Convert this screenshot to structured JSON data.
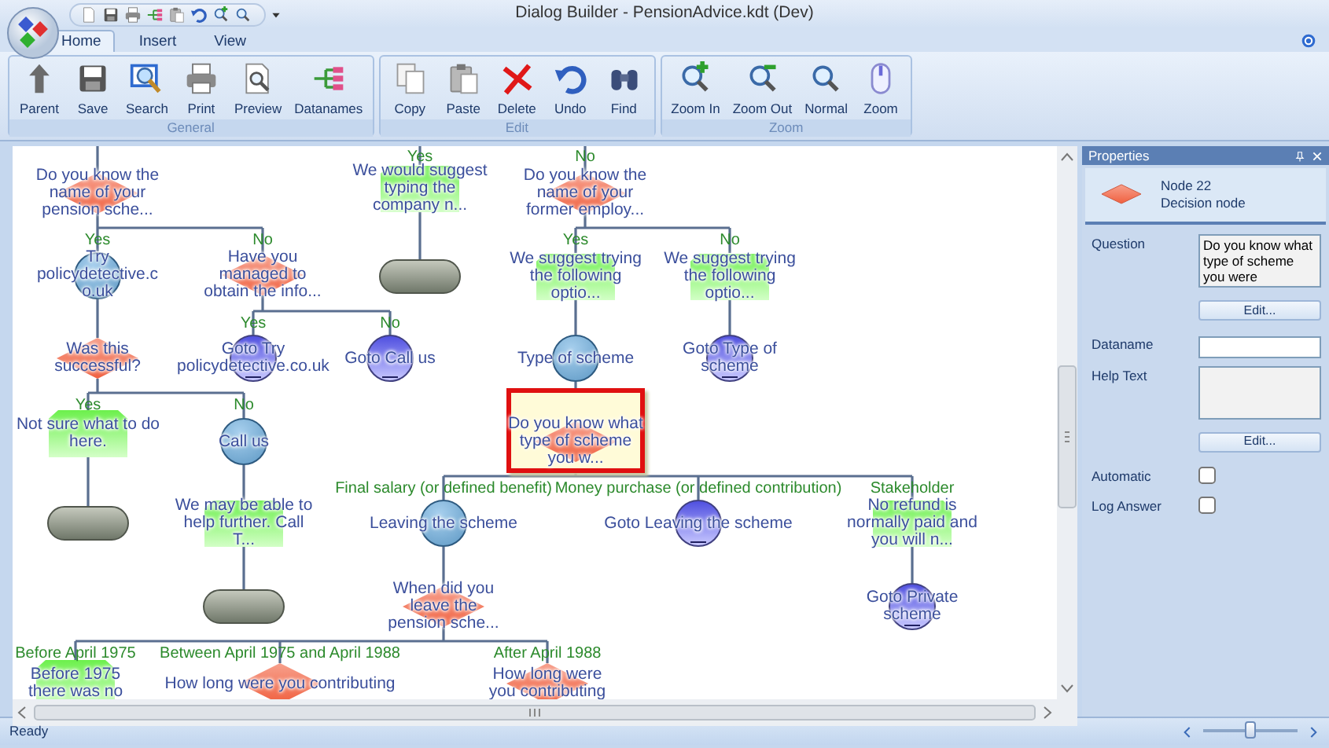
{
  "window": {
    "title": "Dialog Builder - PensionAdvice.kdt (Dev)"
  },
  "tabs": [
    {
      "label": "Home",
      "selected": true
    },
    {
      "label": "Insert",
      "selected": false
    },
    {
      "label": "View",
      "selected": false
    }
  ],
  "ribbon": [
    {
      "label": "General",
      "buttons": [
        {
          "label": "Parent",
          "kind": "parent"
        },
        {
          "label": "Save",
          "kind": "save"
        },
        {
          "label": "Search",
          "kind": "search"
        },
        {
          "label": "Print",
          "kind": "print"
        },
        {
          "label": "Preview",
          "kind": "preview"
        },
        {
          "label": "Datanames",
          "kind": "datanames"
        }
      ]
    },
    {
      "label": "Edit",
      "buttons": [
        {
          "label": "Copy",
          "kind": "copy"
        },
        {
          "label": "Paste",
          "kind": "paste"
        },
        {
          "label": "Delete",
          "kind": "delete"
        },
        {
          "label": "Undo",
          "kind": "undo"
        },
        {
          "label": "Find",
          "kind": "find"
        }
      ]
    },
    {
      "label": "Zoom",
      "buttons": [
        {
          "label": "Zoom In",
          "kind": "zoomin"
        },
        {
          "label": "Zoom Out",
          "kind": "zoomout"
        },
        {
          "label": "Normal",
          "kind": "normal"
        },
        {
          "label": "Zoom",
          "kind": "zoom"
        }
      ]
    }
  ],
  "diagram": {
    "nodes": [
      {
        "kind": "decision",
        "text": "Do you know the name of your pension sche...",
        "selected": false,
        "children": [
          {
            "kind": "info",
            "branch": "Yes",
            "text": "Try policydetective.co.uk",
            "selected": false,
            "children": [
              {
                "kind": "decision",
                "text": "Was this successful?",
                "selected": false,
                "children": [
                  {
                    "kind": "answer",
                    "branch": "Yes",
                    "text": "Not sure what to do here.",
                    "selected": false,
                    "children": [
                      {
                        "kind": "end",
                        "selected": false
                      }
                    ]
                  },
                  {
                    "kind": "info",
                    "branch": "No",
                    "text": "Call us",
                    "selected": false,
                    "children": [
                      {
                        "kind": "answer",
                        "text": "We may be able to help further.  Call T...",
                        "selected": false,
                        "children": [
                          {
                            "kind": "end",
                            "selected": false
                          }
                        ]
                      }
                    ]
                  }
                ]
              }
            ]
          },
          {
            "kind": "decision",
            "branch": "No",
            "text": "Have you managed to obtain the info...",
            "selected": false,
            "children": [
              {
                "kind": "goto",
                "branch": "Yes",
                "text": "Goto Try policydetective.co.uk",
                "selected": false
              },
              {
                "kind": "goto",
                "branch": "No",
                "text": "Goto Call us",
                "selected": false
              }
            ]
          }
        ]
      },
      {
        "kind": "answer",
        "branch": "Yes",
        "text": "We would suggest typing the company n...",
        "selected": false,
        "children": [
          {
            "kind": "end",
            "selected": false
          }
        ]
      },
      {
        "kind": "decision",
        "branch": "No",
        "text": "Do you know the name of your former employ...",
        "selected": false,
        "children": [
          {
            "kind": "answer",
            "branch": "Yes",
            "text": "We suggest trying the following optio...",
            "selected": false,
            "children": [
              {
                "kind": "info",
                "text": "Type of scheme",
                "selected": false,
                "children": [
                  {
                    "kind": "decision",
                    "text": "Do you know what type of scheme you w...",
                    "selected": true,
                    "children": [
                      {
                        "kind": "info",
                        "branch": "Final salary (or defined benefit)",
                        "text": "Leaving the scheme",
                        "selected": false,
                        "children": [
                          {
                            "kind": "decision",
                            "text": "When did you leave the pension sche...",
                            "selected": false,
                            "children": [
                              {
                                "kind": "answer",
                                "branch": "Before April 1975",
                                "text": "Before 1975 there was no",
                                "selected": false
                              },
                              {
                                "kind": "decision",
                                "branch": "Between April 1975 and April 1988",
                                "text": "How long were you contributing",
                                "selected": false
                              },
                              {
                                "kind": "decision",
                                "branch": "After April 1988",
                                "text": "How long were you contributing",
                                "selected": false
                              }
                            ]
                          }
                        ]
                      },
                      {
                        "kind": "goto",
                        "branch": "Money purchase (or defined contribution)",
                        "text": "Goto Leaving the scheme",
                        "selected": false
                      },
                      {
                        "kind": "answer",
                        "branch": "Stakeholder",
                        "text": "No refund is normally paid and you will n...",
                        "selected": false,
                        "children": [
                          {
                            "kind": "goto",
                            "text": "Goto Private scheme",
                            "selected": false
                          }
                        ]
                      }
                    ]
                  }
                ]
              }
            ]
          },
          {
            "kind": "answer",
            "branch": "No",
            "text": "We suggest trying the following optio...",
            "selected": false,
            "children": [
              {
                "kind": "goto",
                "text": "Goto Type of scheme",
                "selected": false
              }
            ]
          }
        ]
      }
    ]
  },
  "properties": {
    "title": "Properties",
    "node_id": "Node 22",
    "node_type": "Decision node",
    "fields": [
      {
        "kind": "textarea",
        "label": "Question",
        "value": "Do you know what type of scheme you were",
        "button": "Edit..."
      },
      {
        "kind": "text",
        "label": "Dataname"
      },
      {
        "kind": "textarea",
        "label": "Help Text",
        "button": "Edit..."
      },
      {
        "kind": "checkbox",
        "label": "Automatic",
        "checked": false
      },
      {
        "kind": "checkbox",
        "label": "Log Answer",
        "checked": false
      }
    ]
  },
  "status_bar": {
    "text": "Ready",
    "zoom": {
      "level": 0.5
    }
  }
}
